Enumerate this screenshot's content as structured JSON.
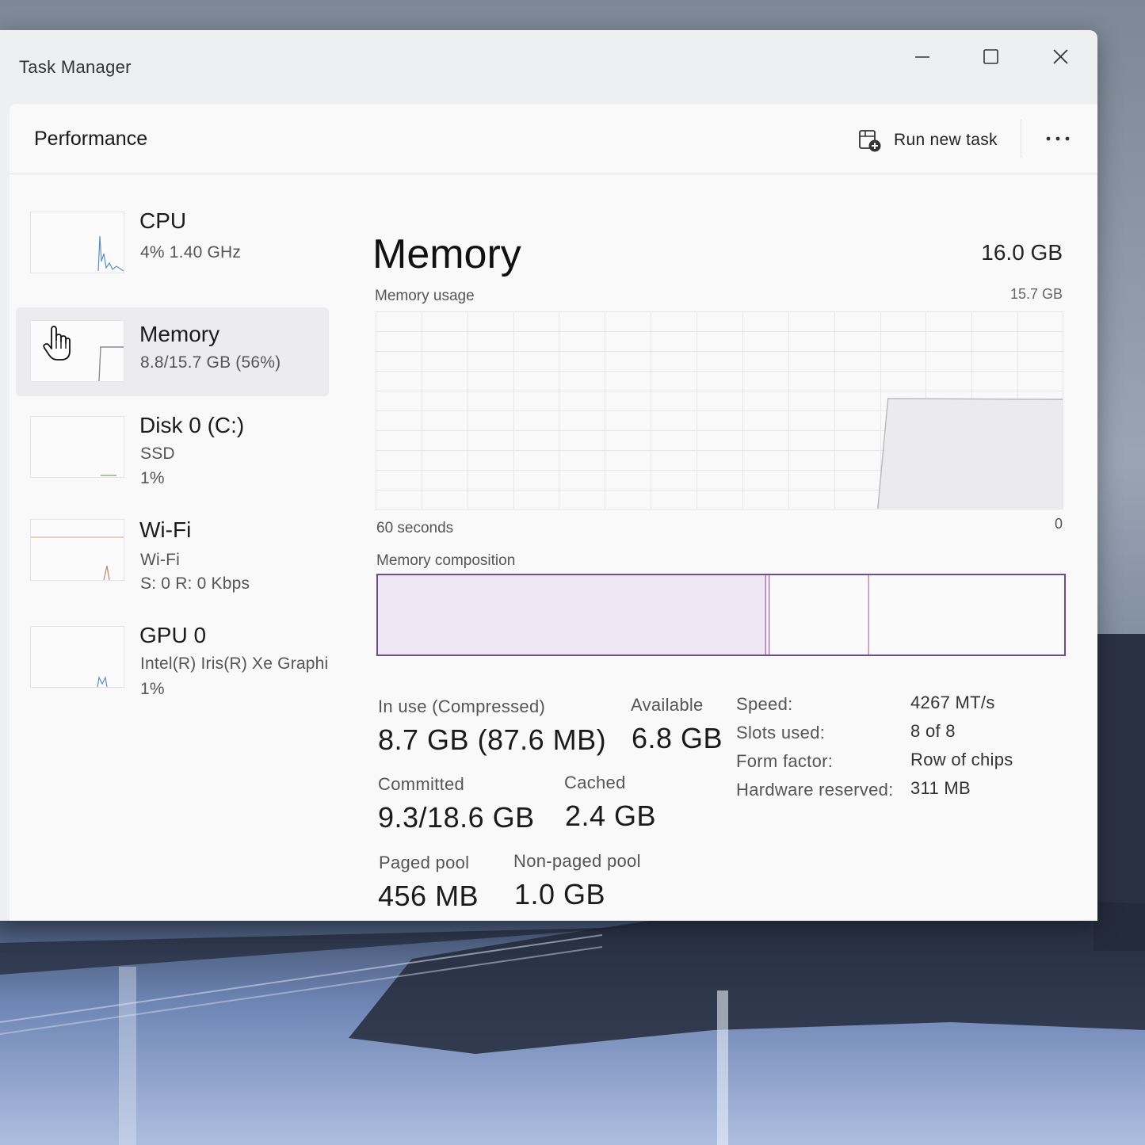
{
  "window": {
    "title": "Task Manager"
  },
  "header": {
    "page_title": "Performance",
    "run_new_task_label": "Run new task"
  },
  "sidebar": {
    "items": [
      {
        "title": "CPU",
        "lines": [
          "4%  1.40 GHz"
        ]
      },
      {
        "title": "Memory",
        "lines": [
          "8.8/15.7 GB (56%)"
        ]
      },
      {
        "title": "Disk 0 (C:)",
        "lines": [
          "SSD",
          "1%"
        ]
      },
      {
        "title": "Wi-Fi",
        "lines": [
          "Wi-Fi",
          "S: 0  R: 0 Kbps"
        ]
      },
      {
        "title": "GPU 0",
        "lines": [
          "Intel(R) Iris(R) Xe Graphi",
          "1%"
        ]
      }
    ]
  },
  "main": {
    "title": "Memory",
    "total": "16.0 GB",
    "usage_label": "Memory usage",
    "usage_max": "15.7 GB",
    "axis_left": "60 seconds",
    "axis_right": "0",
    "composition_label": "Memory composition",
    "composition": {
      "in_use_fraction": 0.565,
      "modified_fraction": 0.005,
      "standby_fraction": 0.145,
      "free_fraction": 0.285
    },
    "usage_fraction": 0.56
  },
  "stats": {
    "in_use_label": "In use (Compressed)",
    "in_use_value": "8.7 GB (87.6 MB)",
    "available_label": "Available",
    "available_value": "6.8 GB",
    "committed_label": "Committed",
    "committed_value": "9.3/18.6 GB",
    "cached_label": "Cached",
    "cached_value": "2.4 GB",
    "paged_label": "Paged pool",
    "paged_value": "456 MB",
    "nonpaged_label": "Non-paged pool",
    "nonpaged_value": "1.0 GB"
  },
  "specs": {
    "speed_label": "Speed:",
    "speed_value": "4267 MT/s",
    "slots_label": "Slots used:",
    "slots_value": "8 of 8",
    "form_label": "Form factor:",
    "form_value": "Row of chips",
    "reserved_label": "Hardware reserved:",
    "reserved_value": "311 MB"
  },
  "colors": {
    "memory_accent": "#8e4fa8",
    "memory_fill": "#efe7f4",
    "graph_line": "#c8c8cc",
    "grid": "#e6e6e9"
  }
}
